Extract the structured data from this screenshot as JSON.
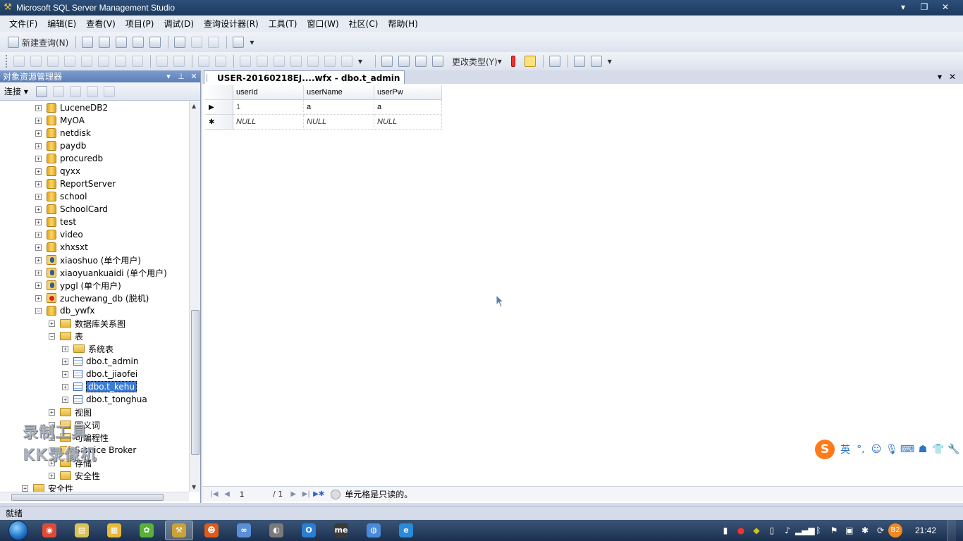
{
  "window": {
    "title": "Microsoft SQL Server Management Studio",
    "controls": {
      "minimize": "▾",
      "restore": "❐",
      "close": "✕"
    }
  },
  "menu": [
    "文件(F)",
    "编辑(E)",
    "查看(V)",
    "项目(P)",
    "调试(D)",
    "查询设计器(R)",
    "工具(T)",
    "窗口(W)",
    "社区(C)",
    "帮助(H)"
  ],
  "toolbar1": {
    "new_query_label": "新建查询(N)"
  },
  "toolbar2": {
    "change_type_label": "更改类型(Y)"
  },
  "explorer": {
    "title": "对象资源管理器",
    "connect_label": "连接",
    "tree": [
      {
        "label": "LuceneDB2",
        "level": 2,
        "icon": "database",
        "exp": "+"
      },
      {
        "label": "MyOA",
        "level": 2,
        "icon": "database",
        "exp": "+"
      },
      {
        "label": "netdisk",
        "level": 2,
        "icon": "database",
        "exp": "+"
      },
      {
        "label": "paydb",
        "level": 2,
        "icon": "database",
        "exp": "+"
      },
      {
        "label": "procuredb",
        "level": 2,
        "icon": "database",
        "exp": "+"
      },
      {
        "label": "qyxx",
        "level": 2,
        "icon": "database",
        "exp": "+"
      },
      {
        "label": "ReportServer",
        "level": 2,
        "icon": "database",
        "exp": "+"
      },
      {
        "label": "school",
        "level": 2,
        "icon": "database",
        "exp": "+"
      },
      {
        "label": "SchoolCard",
        "level": 2,
        "icon": "database",
        "exp": "+"
      },
      {
        "label": "test",
        "level": 2,
        "icon": "database",
        "exp": "+"
      },
      {
        "label": "video",
        "level": 2,
        "icon": "database",
        "exp": "+"
      },
      {
        "label": "xhxsxt",
        "level": 2,
        "icon": "database",
        "exp": "+"
      },
      {
        "label": "xiaoshuo (单个用户)",
        "level": 2,
        "icon": "database-user",
        "exp": "+"
      },
      {
        "label": "xiaoyuankuaidi (单个用户)",
        "level": 2,
        "icon": "database-user",
        "exp": "+"
      },
      {
        "label": "ypgl (单个用户)",
        "level": 2,
        "icon": "database-user",
        "exp": "+"
      },
      {
        "label": "zuchewang_db (脱机)",
        "level": 2,
        "icon": "database-offline",
        "exp": "+"
      },
      {
        "label": "db_ywfx",
        "level": 2,
        "icon": "database",
        "exp": "−"
      },
      {
        "label": "数据库关系图",
        "level": 3,
        "icon": "folder",
        "exp": "+"
      },
      {
        "label": "表",
        "level": 3,
        "icon": "folder",
        "exp": "−"
      },
      {
        "label": "系统表",
        "level": 4,
        "icon": "folder",
        "exp": "+"
      },
      {
        "label": "dbo.t_admin",
        "level": 4,
        "icon": "table",
        "exp": "+"
      },
      {
        "label": "dbo.t_jiaofei",
        "level": 4,
        "icon": "table",
        "exp": "+"
      },
      {
        "label": "dbo.t_kehu",
        "level": 4,
        "icon": "table",
        "exp": "+",
        "selected": true
      },
      {
        "label": "dbo.t_tonghua",
        "level": 4,
        "icon": "table",
        "exp": "+"
      },
      {
        "label": "视图",
        "level": 3,
        "icon": "folder",
        "exp": "+"
      },
      {
        "label": "同义词",
        "level": 3,
        "icon": "folder",
        "exp": "+"
      },
      {
        "label": "可编程性",
        "level": 3,
        "icon": "folder",
        "exp": "+"
      },
      {
        "label": "Service Broker",
        "level": 3,
        "icon": "folder",
        "exp": "+"
      },
      {
        "label": "存储",
        "level": 3,
        "icon": "folder",
        "exp": "+"
      },
      {
        "label": "安全性",
        "level": 3,
        "icon": "folder",
        "exp": "+"
      },
      {
        "label": "安全性",
        "level": 1,
        "icon": "folder",
        "exp": "+"
      }
    ]
  },
  "document": {
    "tab_title": "USER-20160218EJ....wfx - dbo.t_admin",
    "grid": {
      "columns": [
        "userId",
        "userName",
        "userPw"
      ],
      "rows": [
        {
          "indicator": "▶",
          "cells": [
            "1",
            "a",
            "a"
          ]
        },
        {
          "indicator": "✱",
          "cells": [
            "NULL",
            "NULL",
            "NULL"
          ]
        }
      ]
    },
    "navigator": {
      "current": "1",
      "total": "/ 1",
      "status": "单元格是只读的。"
    }
  },
  "watermark": {
    "line1": "录制工具",
    "line2": "KK录像机"
  },
  "ime": {
    "logo": "S",
    "lang": "英"
  },
  "statusbar": {
    "text": "就绪"
  },
  "taskbar": {
    "items": [
      {
        "name": "chrome",
        "glyph": "◉",
        "color": "#dd4b39"
      },
      {
        "name": "notepad",
        "glyph": "▤",
        "color": "#d8c45a"
      },
      {
        "name": "explorer",
        "glyph": "▦",
        "color": "#e8b93c"
      },
      {
        "name": "leaf-app",
        "glyph": "✿",
        "color": "#5ab03a"
      },
      {
        "name": "ssms",
        "glyph": "⚒",
        "color": "#c9a23a",
        "active": true
      },
      {
        "name": "face-app",
        "glyph": "☻",
        "color": "#e05a1a"
      },
      {
        "name": "link-app",
        "glyph": "∞",
        "color": "#5a8fd8"
      },
      {
        "name": "vs-app",
        "glyph": "◐",
        "color": "#7a7a7a"
      },
      {
        "name": "outlook",
        "glyph": "O",
        "color": "#2a7fd4"
      },
      {
        "name": "me-app",
        "glyph": "me",
        "color": "#3a3a3a"
      },
      {
        "name": "globe-app",
        "glyph": "◍",
        "color": "#4a8ad8"
      },
      {
        "name": "ie",
        "glyph": "e",
        "color": "#2a8ad8"
      }
    ],
    "clock": "21:42"
  },
  "colors": {
    "accent": "#3a7bd5",
    "title_bar": "#1d3a5e",
    "taskbar": "#1b3050"
  }
}
